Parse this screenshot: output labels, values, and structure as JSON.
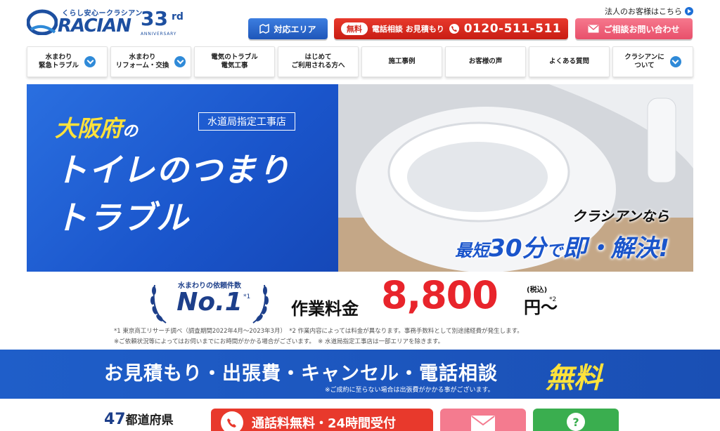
{
  "header": {
    "logo_tagline": "くらし安心ークラシアン",
    "logo_word": "RACIAN",
    "anniversary_number": "33",
    "anniversary_suffix": "rd",
    "anniversary_label": "ANNIVERSARY",
    "corporate_link": "法人のお客様はこちら",
    "area_button": "対応エリア",
    "phone_free_pill": "無料",
    "phone_label": "電話相談 お見積もり",
    "phone_number": "0120-511-511",
    "contact_button": "ご相談お問い合わせ"
  },
  "nav": {
    "items": [
      {
        "label": "水まわり\n緊急トラブル",
        "has_dropdown": true
      },
      {
        "label": "水まわり\nリフォーム・交換",
        "has_dropdown": true
      },
      {
        "label": "電気のトラブル\n電気工事",
        "has_dropdown": false
      },
      {
        "label": "はじめて\nご利用される方へ",
        "has_dropdown": false
      },
      {
        "label": "施工事例",
        "has_dropdown": false
      },
      {
        "label": "お客様の声",
        "has_dropdown": false
      },
      {
        "label": "よくある質問",
        "has_dropdown": false
      },
      {
        "label": "クラシアンに\nついて",
        "has_dropdown": true
      }
    ]
  },
  "hero": {
    "city": "大阪府",
    "city_particle": "の",
    "tag": "水道局指定工事店",
    "title_line1": "トイレのつまり",
    "title_line2": "トラブル",
    "slogan_line1": "クラシアンなら",
    "slogan_short": "最短",
    "slogan_minutes": "30分",
    "slogan_de": "で",
    "slogan_resolve": "即・解決!"
  },
  "price": {
    "badge_caption": "水まわりの依頼件数",
    "badge_text": "No.1",
    "badge_mark": "*1",
    "label": "作業料金",
    "value": "8,800",
    "unit": "円〜",
    "tax": "(税込)",
    "mark": "*2",
    "note1": "*1 東京商工リサーチ調べ（調査期間2022年4月〜2023年3月）　*2 作業内容によっては料金が異なります。事務手数料として別途諸経費が発生します。",
    "note2": "※ご依頼状況等によってはお伺いまでにお時間がかかる場合がございます。　※ 水道局指定工事店は一部エリアを除きます。"
  },
  "free_banner": {
    "main": "お見積もり・出張費・キャンセル・電話相談",
    "word": "無料",
    "sub": "※ご成約に至らない場合は出張費がかかる事がございます。"
  },
  "bottom": {
    "prefectures_number": "47",
    "prefectures_label": "都道府県",
    "call_text": "通話料無料・24時間受付"
  },
  "colors": {
    "brand_blue": "#1d4fa0",
    "hero_blue": "#1a55cb",
    "accent_red": "#e8242b",
    "accent_yellow": "#ffe23b",
    "contact_pink": "#f47b8f",
    "help_green": "#3aae4f"
  }
}
